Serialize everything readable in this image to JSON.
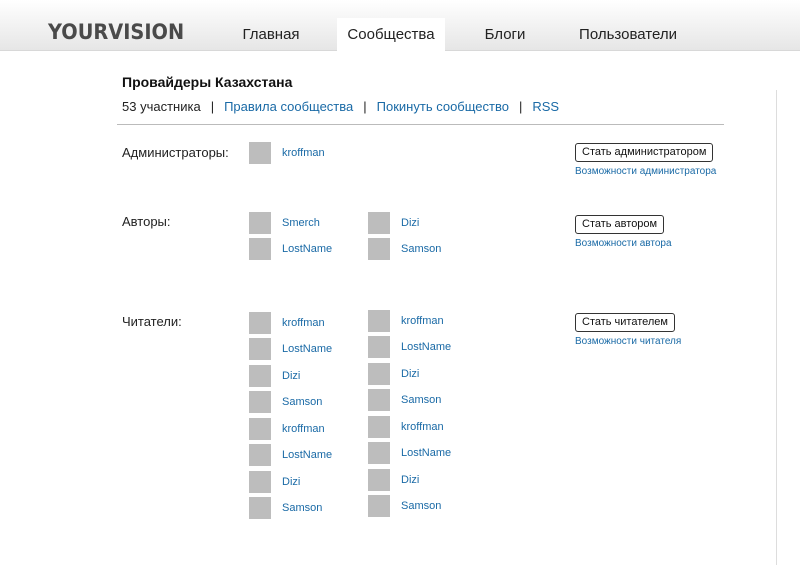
{
  "header": {
    "logo": "YOURVISION",
    "tabs": [
      "Главная",
      "Сообщества",
      "Блоги",
      "Пользователи"
    ],
    "active_tab": "Сообщества"
  },
  "community": {
    "title": "Провайдеры Казахстана",
    "members_count": "53 участника",
    "rules_link": "Правила сообщества",
    "leave_link": "Покинуть сообщество",
    "rss_link": "RSS",
    "separator": "|"
  },
  "sections": {
    "admins": {
      "label": "Администраторы:",
      "button": "Стать администратором",
      "link": "Возможности администратора",
      "members": [
        "kroffman"
      ]
    },
    "authors": {
      "label": "Авторы:",
      "button": "Стать автором",
      "link": "Возможности автора",
      "members": [
        "Smerch",
        "LostName",
        "Dizi",
        "Samson"
      ]
    },
    "readers": {
      "label": "Читатели:",
      "button": "Стать читателем",
      "link": "Возможности читателя",
      "members": [
        "kroffman",
        "LostName",
        "Dizi",
        "Samson",
        "kroffman",
        "LostName",
        "Dizi",
        "Samson",
        "kroffman",
        "LostName",
        "Dizi",
        "Samson",
        "kroffman",
        "LostName",
        "Dizi",
        "Samson"
      ]
    }
  },
  "colors": {
    "link": "#1a6aa6",
    "avatar": "#bdbdbd",
    "header_bg": "#e6e6e6"
  }
}
